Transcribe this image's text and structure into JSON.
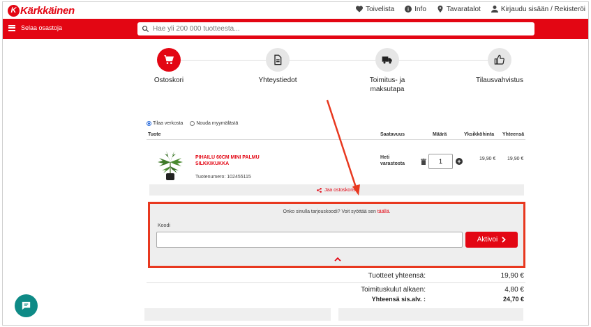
{
  "header": {
    "logo_letter": "K",
    "logo_text": "Kärkkäinen",
    "links": [
      {
        "label": "Toivelista",
        "icon": "heart-icon"
      },
      {
        "label": "Info",
        "icon": "info-icon"
      },
      {
        "label": "Tavaratalot",
        "icon": "location-pin-icon"
      },
      {
        "label": "Kirjaudu sisään / Rekisteröi",
        "icon": "user-icon"
      }
    ]
  },
  "nav": {
    "menu_label": "Selaa osastoja",
    "search_placeholder": "Hae yli 200 000 tuotteesta..."
  },
  "steps": [
    {
      "label": "Ostoskori",
      "icon": "cart-icon",
      "active": true
    },
    {
      "label": "Yhteystiedot",
      "icon": "document-icon",
      "active": false
    },
    {
      "label": "Toimitus- ja maksutapa",
      "icon": "truck-icon",
      "active": false
    },
    {
      "label": "Tilausvahvistus",
      "icon": "thumbs-up-icon",
      "active": false
    }
  ],
  "delivery": {
    "option_online": "Tilaa verkosta",
    "option_pickup": "Nouda myymälästä",
    "selected": "Tilaa verkosta"
  },
  "cart": {
    "columns": {
      "product": "Tuote",
      "availability": "Saatavuus",
      "quantity": "Määrä",
      "unit_price": "Yksikköhinta",
      "total": "Yhteensä"
    },
    "item": {
      "name": "PIHAILU 60CM MINI PALMU SILKKIKUKKA",
      "product_number": "Tuotenumero: 102455115",
      "availability": "Heti varastosta",
      "quantity": "1",
      "unit_price": "19,90 €",
      "total": "19,90 €"
    },
    "share_label": "Jaa ostoskorisi"
  },
  "promo": {
    "question": "Onko sinulla tarjouskoodi? Voit syöttää sen",
    "link": "täällä",
    "code_label": "Koodi",
    "button_label": "Aktivoi"
  },
  "totals": {
    "products_label": "Tuotteet yhteensä:",
    "products_value": "19,90 €",
    "shipping_label": "Toimituskulut alkaen:",
    "shipping_value": "4,80 €",
    "grand_label": "Yhteensä sis.alv. :",
    "grand_value": "24,70 €"
  },
  "colors": {
    "brand_red": "#e30613",
    "annotation_red": "#e8381f",
    "chat_teal": "#0e8a86"
  }
}
